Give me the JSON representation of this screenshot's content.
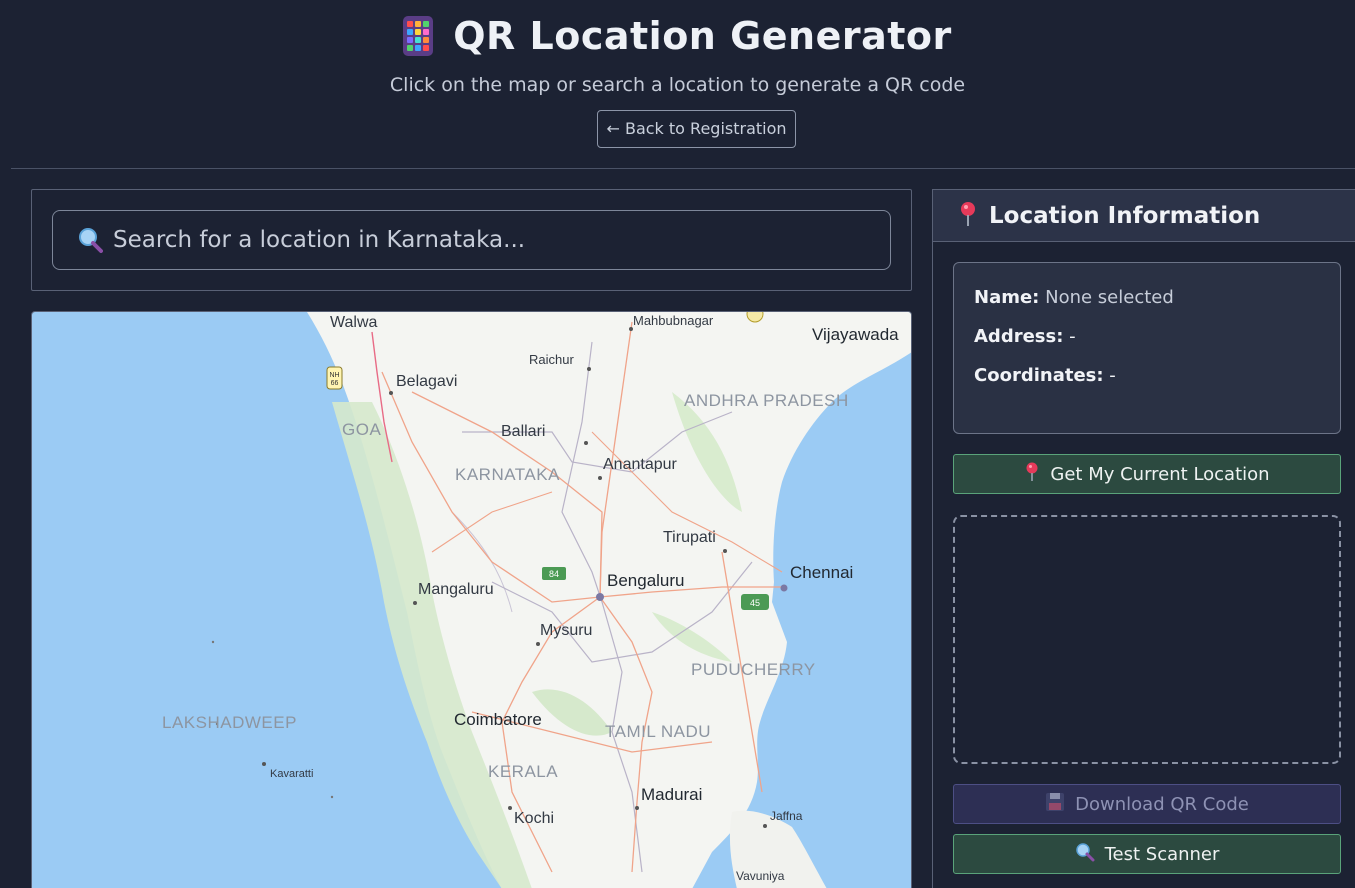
{
  "header": {
    "title": "QR Location Generator",
    "title_icon": "mobile-phone-icon",
    "subtitle": "Click on the map or search a location to generate a QR code",
    "back_label": "← Back to Registration"
  },
  "search": {
    "placeholder": "Search for a location in Karnataka...",
    "icon": "magnifier-icon"
  },
  "map": {
    "highway_shields": [
      "NH 66",
      "84",
      "45"
    ],
    "places": [
      {
        "key": "walwa",
        "name": "Walwa"
      },
      {
        "key": "mahbubnagar",
        "name": "Mahbubnagar"
      },
      {
        "key": "vijayawada",
        "name": "Vijayawada"
      },
      {
        "key": "raichur",
        "name": "Raichur"
      },
      {
        "key": "belagavi",
        "name": "Belagavi"
      },
      {
        "key": "andhra",
        "name": "ANDHRA PRADESH"
      },
      {
        "key": "goa",
        "name": "GOA"
      },
      {
        "key": "ballari",
        "name": "Ballari"
      },
      {
        "key": "anantapur",
        "name": "Anantapur"
      },
      {
        "key": "karnataka",
        "name": "KARNATAKA"
      },
      {
        "key": "tirupati",
        "name": "Tirupati"
      },
      {
        "key": "chennai",
        "name": "Chennai"
      },
      {
        "key": "bengaluru",
        "name": "Bengaluru"
      },
      {
        "key": "mangaluru",
        "name": "Mangaluru"
      },
      {
        "key": "mysuru",
        "name": "Mysuru"
      },
      {
        "key": "puducherry",
        "name": "PUDUCHERRY"
      },
      {
        "key": "lakshadweep",
        "name": "LAKSHADWEEP"
      },
      {
        "key": "coimbatore",
        "name": "Coimbatore"
      },
      {
        "key": "tamilnadu",
        "name": "TAMIL NADU"
      },
      {
        "key": "kavaratti",
        "name": "Kavaratti"
      },
      {
        "key": "kerala",
        "name": "KERALA"
      },
      {
        "key": "madurai",
        "name": "Madurai"
      },
      {
        "key": "jaffna",
        "name": "Jaffna"
      },
      {
        "key": "kochi",
        "name": "Kochi"
      },
      {
        "key": "vavuniya",
        "name": "Vavuniya"
      }
    ]
  },
  "panel": {
    "title": "Location Information",
    "title_icon": "pushpin-icon",
    "name_label": "Name:",
    "name_value": "None selected",
    "address_label": "Address:",
    "address_value": "-",
    "coords_label": "Coordinates:",
    "coords_value": "-",
    "current_location_label": "Get My Current Location",
    "download_label": "Download QR Code",
    "download_icon": "floppy-disk-icon",
    "test_scanner_label": "Test Scanner"
  },
  "colors": {
    "background": "#1c2233",
    "panel_header": "#2c3348",
    "green_button": "#2c4a40",
    "purple_button": "#2d2f54",
    "sea": "#9bcbf4",
    "land": "#f4f5f2"
  }
}
